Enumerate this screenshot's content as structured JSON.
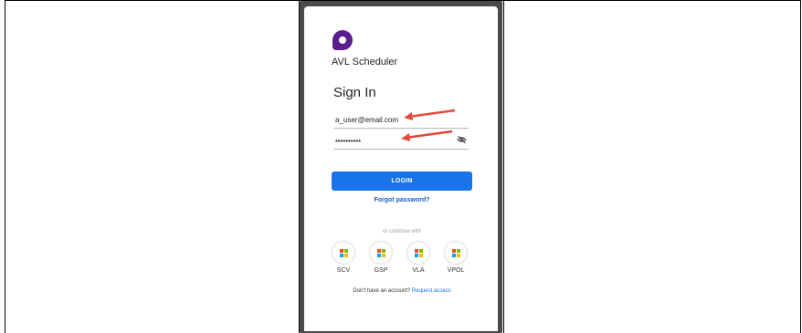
{
  "app": {
    "name": "AVL Scheduler",
    "brand_color": "#5b1e8c",
    "logo_icon": "avl-logo-icon"
  },
  "login": {
    "title": "Sign In",
    "email_value": "a_user@email.com",
    "password_value": "••••••••••",
    "password_toggle_icon": "eye-off-icon",
    "login_label": "LOGIN",
    "forgot_label": "Forgot password?",
    "continue_label": "or continue with",
    "accent_color": "#1a73e8"
  },
  "providers": [
    {
      "label": "SCV",
      "icon": "microsoft-icon"
    },
    {
      "label": "GSP",
      "icon": "microsoft-icon"
    },
    {
      "label": "VLA",
      "icon": "microsoft-icon"
    },
    {
      "label": "VPOL",
      "icon": "microsoft-icon"
    }
  ],
  "signup": {
    "prompt": "Don't have an account?",
    "link_label": "Request access"
  },
  "annotations": {
    "arrow_color": "#e8473c"
  }
}
